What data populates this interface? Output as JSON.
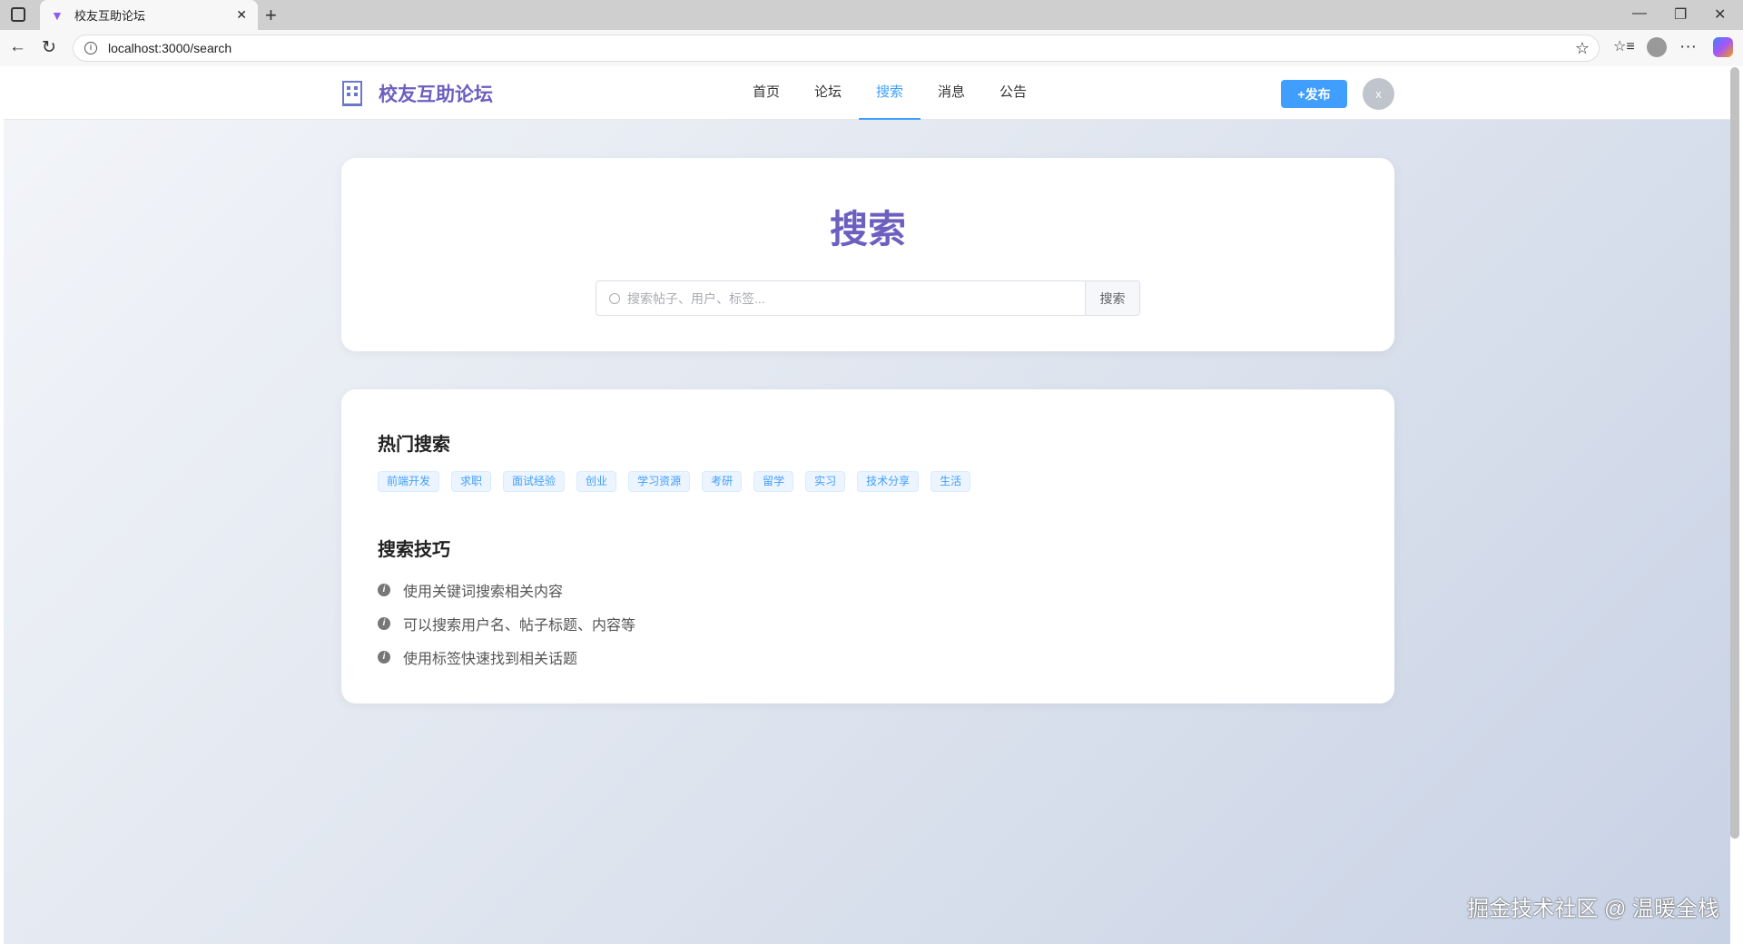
{
  "browser": {
    "tab_title": "校友互助论坛",
    "url": "localhost:3000/search"
  },
  "header": {
    "logo_text": "校友互助论坛",
    "nav": [
      "首页",
      "论坛",
      "搜索",
      "消息",
      "公告"
    ],
    "active_nav": "搜索",
    "publish_label": "+发布",
    "avatar_letter": "x"
  },
  "search": {
    "title": "搜索",
    "placeholder": "搜索帖子、用户、标签...",
    "button": "搜索"
  },
  "hot": {
    "heading": "热门搜索",
    "tags": [
      "前端开发",
      "求职",
      "面试经验",
      "创业",
      "学习资源",
      "考研",
      "留学",
      "实习",
      "技术分享",
      "生活"
    ]
  },
  "tips": {
    "heading": "搜索技巧",
    "items": [
      "使用关键词搜索相关内容",
      "可以搜索用户名、帖子标题、内容等",
      "使用标签快速找到相关话题"
    ]
  },
  "watermark": "掘金技术社区 @ 温暖全栈",
  "colors": {
    "accent": "#409eff",
    "brand": "#6c5fc0"
  }
}
